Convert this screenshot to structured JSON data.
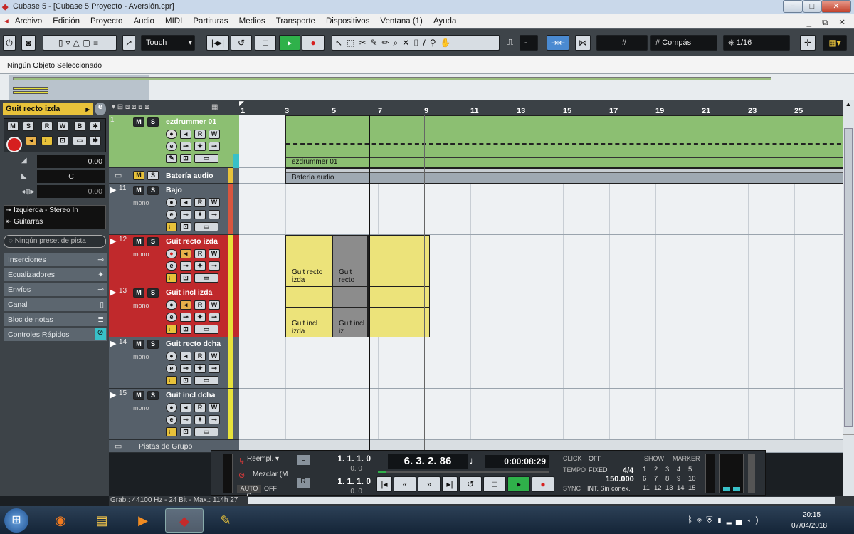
{
  "window": {
    "title": "Cubase 5 - [Cubase 5 Proyecto - Aversión.cpr]",
    "minimize": "−",
    "restore": "□",
    "close": "✕"
  },
  "menu": [
    "Archivo",
    "Edición",
    "Proyecto",
    "Audio",
    "MIDI",
    "Partituras",
    "Medios",
    "Transporte",
    "Dispositivos",
    "Ventana (1)",
    "Ayuda"
  ],
  "toolbar": {
    "automation_mode": "Touch",
    "snap_value": "-",
    "grid_type": "Compás",
    "quantize": "1/16"
  },
  "info_line": "Ningún Objeto Seleccionado",
  "inspector": {
    "track_name": "Guit recto izda",
    "volume": "0.00",
    "pan": "C",
    "delay": "0.00",
    "input": "Izquierda - Stereo In",
    "output": "Guitarras",
    "preset": "Ningún preset de pista",
    "sections": [
      "Inserciones",
      "Ecualizadores",
      "Envíos",
      "Canal",
      "Bloc de notas",
      "Controles Rápidos"
    ]
  },
  "tracks": [
    {
      "num": "1",
      "name": "ezdrummer 01",
      "color": "#8cbf72",
      "mode": ""
    },
    {
      "num": "",
      "name": "Batería audio",
      "color": "#e8c23a",
      "mode": ""
    },
    {
      "num": "11",
      "name": "Bajo",
      "color": "#d8553e",
      "mode": "mono"
    },
    {
      "num": "12",
      "name": "Guit recto izda",
      "color": "#e8e23a",
      "mode": "mono"
    },
    {
      "num": "13",
      "name": "Guit incl izda",
      "color": "#e8e23a",
      "mode": "mono"
    },
    {
      "num": "14",
      "name": "Guit recto dcha",
      "color": "#e8e23a",
      "mode": "mono"
    },
    {
      "num": "15",
      "name": "Guit incl dcha",
      "color": "#e8e23a",
      "mode": "mono"
    }
  ],
  "group_tracks_label": "Pistas de Grupo",
  "ruler": [
    "1",
    "3",
    "5",
    "7",
    "9",
    "11",
    "13",
    "15",
    "17",
    "19",
    "21",
    "23",
    "25"
  ],
  "events": {
    "drum": "ezdrummer 01",
    "drum_folder": "Batería audio",
    "g12a": "Guit recto izda",
    "g12b": "Guit recto",
    "g13a": "Guit incl izda",
    "g13b": "Guit incl iz"
  },
  "transport": {
    "preroll": "Reempl.",
    "mix": "Mezclar (M",
    "autoq": "AUTO Q",
    "autoq_val": "OFF",
    "left_locator": "1. 1. 1.  0",
    "left_sub": "0.  0",
    "right_locator": "1. 1. 1.  0",
    "right_sub": "0.  0",
    "position": "6. 3. 2. 86",
    "time": "0:00:08:29",
    "click": "CLICK",
    "click_val": "OFF",
    "tempo": "TEMPO",
    "tempo_mode": "FIXED",
    "signature": "4/4",
    "bpm": "150.000",
    "sync": "SYNC",
    "sync_val": "INT. Sin conex.",
    "show": "SHOW",
    "marker": "MARKER",
    "markers": [
      "1",
      "2",
      "3",
      "4",
      "5",
      "6",
      "7",
      "8",
      "9",
      "10",
      "11",
      "12",
      "13",
      "14",
      "15"
    ]
  },
  "status": "Grab.: 44100 Hz - 24 Bit - Max.: 114h 27",
  "taskbar": {
    "time": "20:15",
    "date": "07/04/2018"
  }
}
